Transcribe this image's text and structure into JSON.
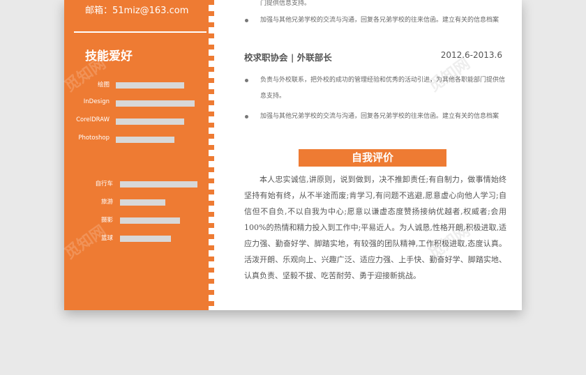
{
  "contact": {
    "email_line": "邮箱：51miz@163.com"
  },
  "sidebar": {
    "skills_heading": "技能爱好",
    "software": [
      {
        "name": "绘图",
        "level": 0.65
      },
      {
        "name": "InDesign",
        "level": 0.75
      },
      {
        "name": "CorelDRAW",
        "level": 0.65
      },
      {
        "name": "Photoshop",
        "level": 0.56
      }
    ],
    "hobbies": [
      {
        "name": "自行车",
        "level": 0.85
      },
      {
        "name": "旅游",
        "level": 0.5
      },
      {
        "name": "摄影",
        "level": 0.66
      },
      {
        "name": "篮球",
        "level": 0.56
      }
    ]
  },
  "main": {
    "top_bullet_tail": "门提供信息支持。",
    "top_bullet": "加强与其他兄弟学校的交流与沟通，回复各兄弟学校的往来信函。建立有关的信息档案",
    "job": {
      "title": "校求职协会 | 外联部长",
      "date": "2012.6-2013.6"
    },
    "job_bullets": [
      "负责与外校联系，把外校的成功的管理经验和优秀的活动引进，为其他各职能部门提供信息支持。",
      "加强与其他兄弟学校的交流与沟通，回复各兄弟学校的往来信函。建立有关的信息档案"
    ],
    "eval_title": "自我评价",
    "eval_text": "本人忠实诚信,讲原则，说到做到，决不推卸责任;有自制力，做事情始终坚持有始有终，从不半途而废;肯学习,有问题不逃避,愿意虚心向他人学习;自信但不自负,不以自我为中心;愿意以谦虚态度赞扬接纳优越者,权威者;会用100%的热情和精力投入到工作中;平易近人。为人诚恳,性格开朗,积极进取,适应力强、勤奋好学、脚踏实地，有较强的团队精神,工作积极进取,态度认真。活泼开朗、乐观向上、兴趣广泛、适应力强、上手快、勤奋好学、脚踏实地、认真负责、坚毅不拔、吃苦耐劳、勇于迎接新挑战。"
  },
  "watermark": "觅知网",
  "colors": {
    "accent": "#ee7b33",
    "bar": "#d8d8d8"
  }
}
